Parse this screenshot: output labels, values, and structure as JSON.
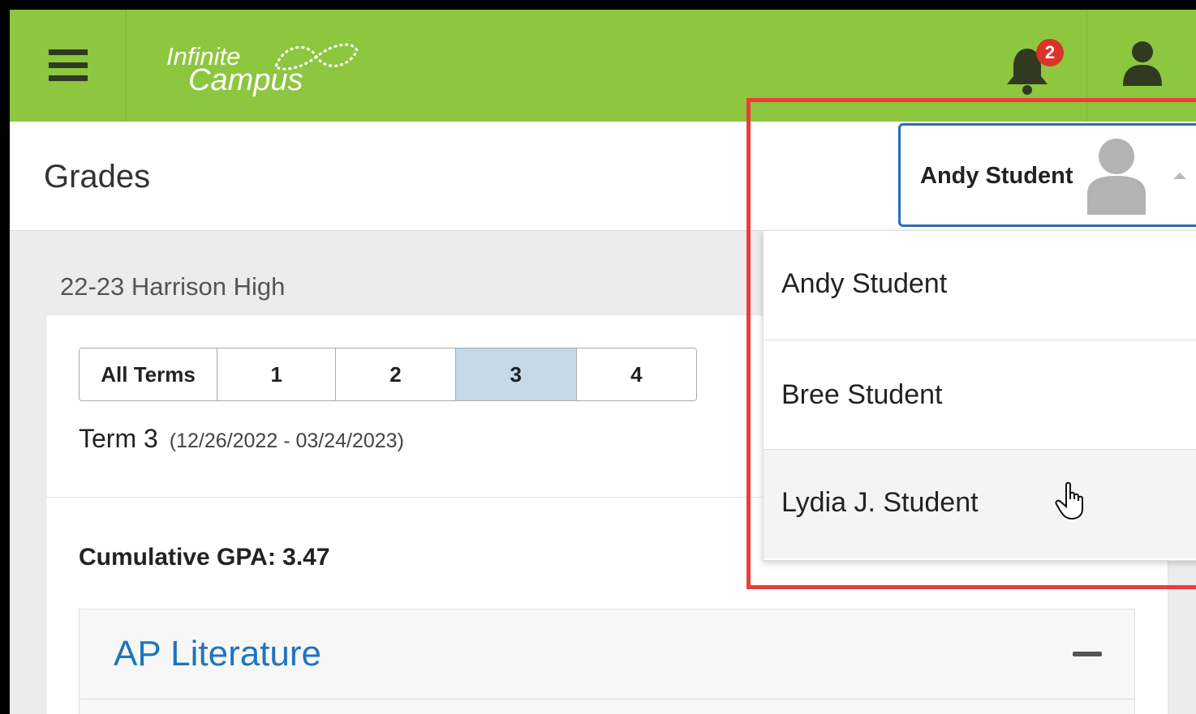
{
  "app": {
    "logo_line1": "Infinite",
    "logo_line2": "Campus",
    "notification_count": "2",
    "accent_color": "#8dc63f"
  },
  "page": {
    "title": "Grades",
    "school": "22-23 Harrison High"
  },
  "terms": {
    "buttons": [
      "All Terms",
      "1",
      "2",
      "3",
      "4"
    ],
    "active": "3",
    "current_label": "Term 3",
    "current_dates": "(12/26/2022 - 03/24/2023)"
  },
  "gpa": {
    "label": "Cumulative GPA: 3.47"
  },
  "course": {
    "name": "AP Literature"
  },
  "student_selector": {
    "selected": "Andy Student",
    "options": [
      "Andy Student",
      "Bree Student",
      "Lydia J. Student"
    ],
    "hovered": "Lydia J. Student"
  },
  "icons": {
    "menu": "hamburger-icon",
    "bell": "bell-icon",
    "user": "user-icon",
    "avatar": "avatar-icon",
    "caret": "caret-up-icon",
    "collapse": "minus-icon",
    "cursor": "hand-pointer-icon"
  }
}
